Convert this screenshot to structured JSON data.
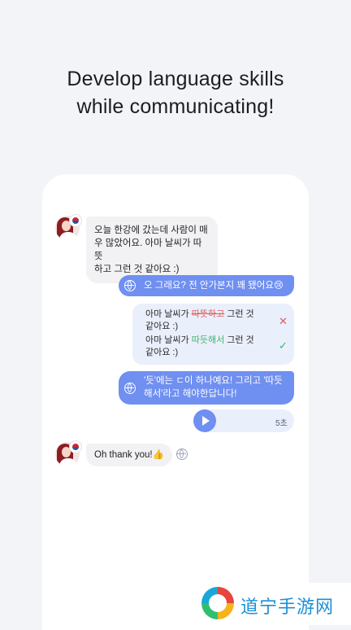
{
  "headline": {
    "line1": "Develop language skills",
    "line2": "while communicating!"
  },
  "chat": {
    "incoming1": {
      "line1": "오늘 한강에 갔는데 사람이 매",
      "line2": "우 많았어요. 아마 날씨가 따뜻",
      "line3": "하고 그런 것 같아요 :)"
    },
    "outgoing1": "오 그래요? 전 안가본지 꽤 됐어요😢",
    "correction": {
      "wrong_prefix": "아마 날씨가 ",
      "wrong_word": "따뜻하고",
      "wrong_suffix": " 그런 것",
      "wrong_line2": "같아요 :)",
      "right_prefix": "아마 날씨가 ",
      "right_word": "따듯해서",
      "right_suffix": " 그런 것",
      "right_line2": "같아요 :)"
    },
    "outgoing2": {
      "line1": "'듯'에는 ㄷ이 하나예요! 그리고 '따듯",
      "line2": "해서'라고 해야한답니다!"
    },
    "voice_duration": "5초",
    "incoming2": "Oh thank you!👍"
  },
  "colors": {
    "accent": "#6f8ff1",
    "wrong": "#e25a5a",
    "right": "#3fb56a"
  },
  "watermark": "道宁手游网"
}
